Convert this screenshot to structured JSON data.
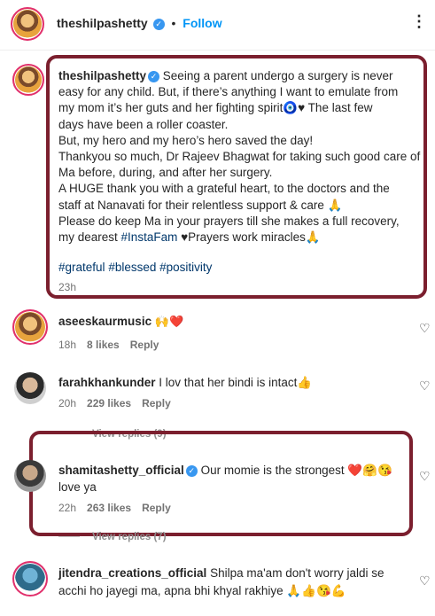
{
  "header": {
    "username": "theshilpashetty",
    "dot": "•",
    "follow_label": "Follow",
    "more_label": "⋮"
  },
  "caption": {
    "username": "theshilpashetty",
    "text_lines": [
      "Seeing a parent undergo a surgery is never",
      "easy for any child. But, if there’s anything I want to emulate from",
      "my mom it’s her guts and her fighting spirit🧿♥ The last few",
      "days have been a roller coaster.",
      "But, my hero and my hero’s hero saved the day!",
      "Thankyou so much, Dr Rajeev Bhagwat for taking such good care of",
      "Ma before, during, and after her surgery.",
      "A HUGE thank you with a grateful heart, to the doctors and the",
      "staff at Nanavati for their relentless support & care 🙏",
      "Please do keep Ma in your prayers till she makes a full recovery,",
      "my dearest",
      "#InstaFam",
      "♥Prayers work miracles🙏"
    ],
    "hashtags": [
      "#grateful",
      "#blessed",
      "#positivity"
    ],
    "time": "23h"
  },
  "comments": [
    {
      "username": "aseeskaurmusic",
      "text": "🙌❤️",
      "time": "18h",
      "likes": "8 likes",
      "reply": "Reply"
    },
    {
      "username": "farahkhankunder",
      "text": "I lov that her bindi is intact👍",
      "time": "20h",
      "likes": "229 likes",
      "reply": "Reply"
    },
    {
      "username": "shamitashetty_official",
      "text_line1": "Our momie is the strongest ❤️🤗😘",
      "text_line2": "love ya",
      "time": "22h",
      "likes": "263 likes",
      "reply": "Reply",
      "view_replies_above": "View replies (9)"
    },
    {
      "username": "jitendra_creations_official",
      "text_line1": "Shilpa ma'am don't worry jaldi se",
      "text_line2": "acchi ho jayegi ma, apna bhi khyal rakhiye 🙏👍😘💪",
      "view_replies_above": "View replies (7)"
    }
  ],
  "icons": {
    "heart": "heart-outline-icon",
    "verified": "verified-badge-icon"
  },
  "colors": {
    "highlight_border": "#7b1f2e",
    "link": "#00376b",
    "follow": "#0095f6"
  }
}
